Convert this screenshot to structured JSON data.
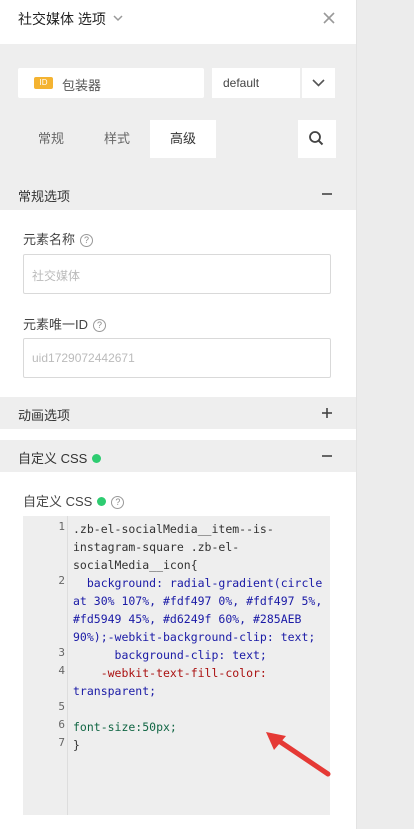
{
  "header": {
    "title": "社交媒体 选项"
  },
  "widget": {
    "badge": "ID",
    "name": "包装器",
    "preset": "default"
  },
  "tabs": [
    {
      "label": "常规"
    },
    {
      "label": "样式"
    },
    {
      "label": "高级"
    }
  ],
  "sections": {
    "general": {
      "label": "常规选项",
      "ctrl": "−"
    },
    "animation": {
      "label": "动画选项",
      "ctrl": "+"
    },
    "custom_css": {
      "label": "自定义 CSS",
      "ctrl": "−"
    }
  },
  "fields": {
    "element_name": {
      "label": "元素名称",
      "placeholder": "社交媒体"
    },
    "element_id": {
      "label": "元素唯一ID",
      "placeholder": "uid1729072442671"
    },
    "custom_css": {
      "label": "自定义 CSS"
    }
  },
  "editor": {
    "line_numbers": [
      "1",
      "2",
      "3",
      "4",
      "5",
      "6",
      "7"
    ],
    "lines": [
      ".zb-el-socialMedia__item--is-",
      "instagram-square .zb-el-",
      "socialMedia__icon{",
      "  background: radial-gradient(circle",
      "at 30% 107%, #fdf497 0%, #fdf497 5%,",
      "#fd5949 45%, #d6249f 60%, #285AEB",
      "90%);-webkit-background-clip: text;",
      "      background-clip: text;",
      "    -webkit-text-fill-color:",
      "transparent;",
      "",
      "font-size:50px;",
      "}"
    ]
  },
  "colors": {
    "accent_dot": "#2ecc71",
    "badge": "#f4b331",
    "arrow": "#e53935"
  },
  "icons": [
    "chevron-down-icon",
    "close-icon",
    "search-icon",
    "help-icon",
    "minus-icon",
    "plus-icon",
    "arrow-annotation"
  ]
}
